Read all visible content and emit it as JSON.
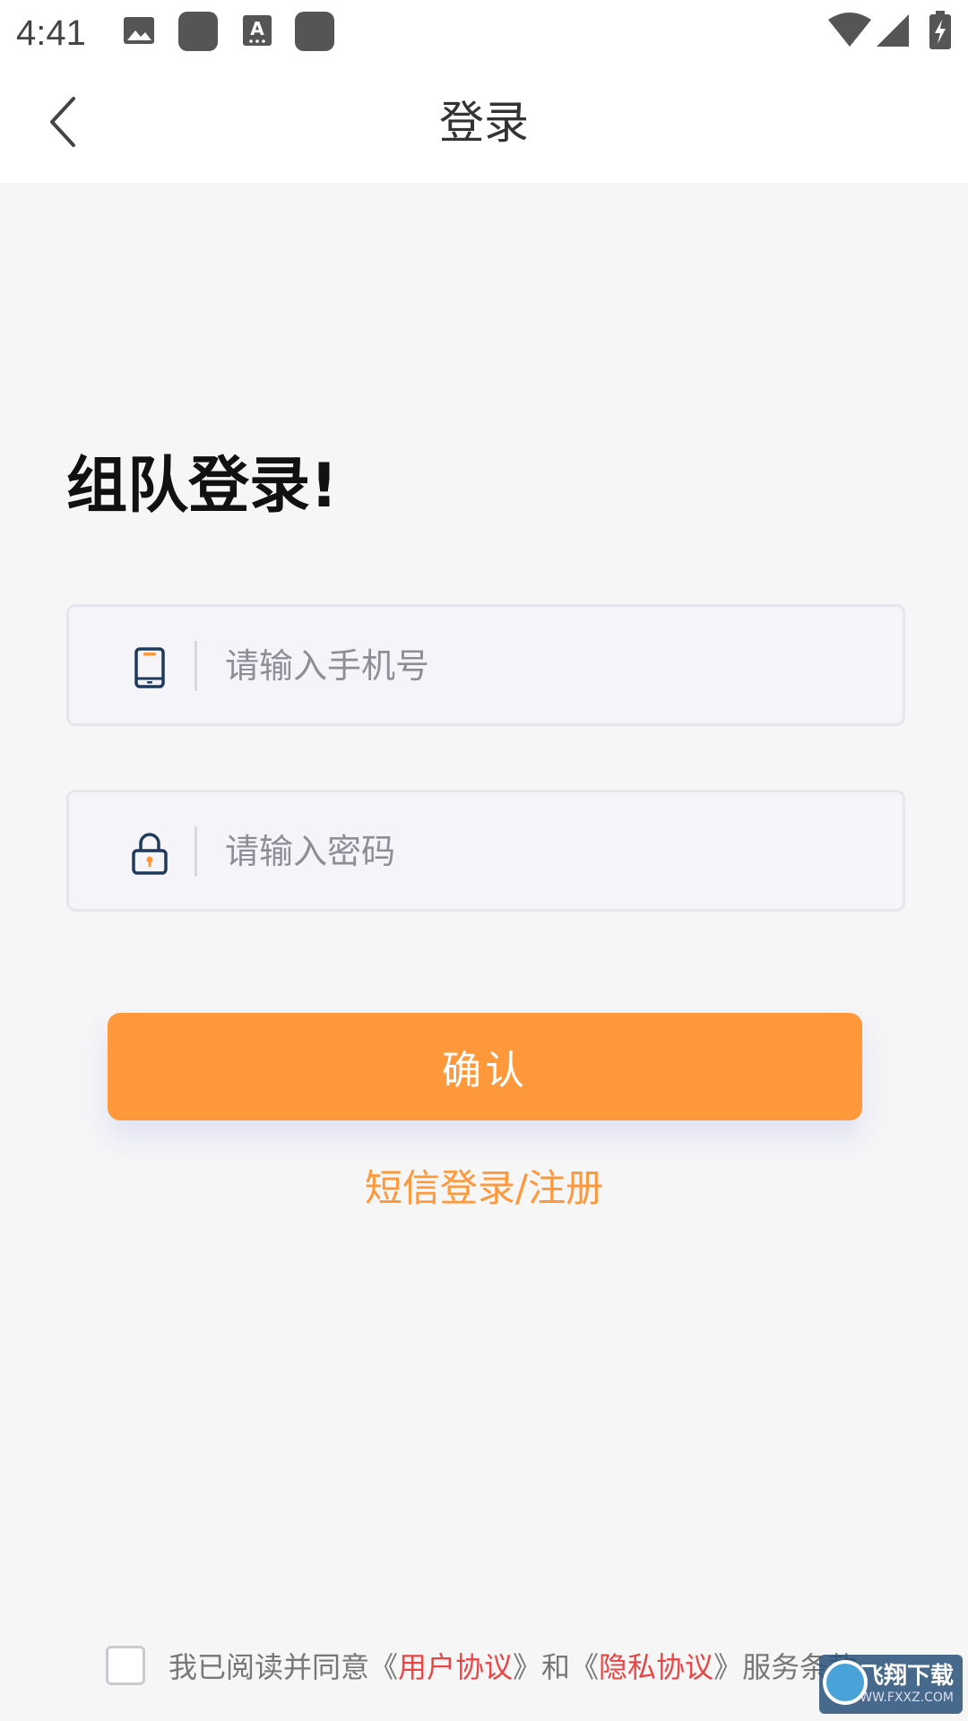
{
  "status_bar": {
    "time": "4:41",
    "icons": [
      "image-icon",
      "app-icon",
      "text-a-icon",
      "app-icon",
      "wifi-icon",
      "signal-icon",
      "battery-charging-icon"
    ]
  },
  "app_bar": {
    "title": "登录",
    "back_icon": "chevron-left-icon"
  },
  "main": {
    "heading": "组队登录!",
    "phone_field": {
      "placeholder": "请输入手机号",
      "value": "",
      "icon": "phone-icon"
    },
    "password_field": {
      "placeholder": "请输入密码",
      "value": "",
      "icon": "lock-icon"
    },
    "confirm_label": "确认",
    "sms_link": "短信登录/注册"
  },
  "agreement": {
    "checked": false,
    "prefix": "我已阅读并同意《",
    "user_agreement": "用户协议",
    "middle": "》和《",
    "privacy_agreement": "隐私协议",
    "suffix": "》服务条款"
  },
  "watermark": {
    "main": "飞翔下载",
    "sub": "WWW.FXXZ.COM"
  },
  "colors": {
    "accent": "#fe983a",
    "link_red": "#e94545",
    "background": "#f6f6f7",
    "field_bg": "#f4f4f9"
  }
}
